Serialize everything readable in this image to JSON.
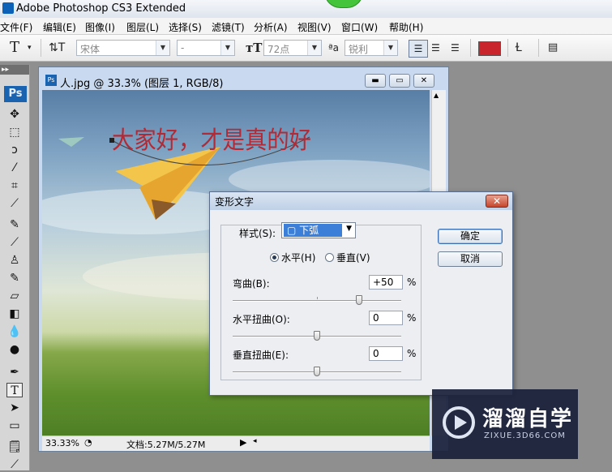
{
  "app": {
    "title": "Adobe Photoshop CS3 Extended",
    "menus": [
      "文件(F)",
      "编辑(E)",
      "图像(I)",
      "图层(L)",
      "选择(S)",
      "滤镜(T)",
      "分析(A)",
      "视图(V)",
      "窗口(W)",
      "帮助(H)"
    ]
  },
  "options": {
    "font_family": "宋体",
    "font_style": "-",
    "font_size": "72点",
    "antialias": "锐利",
    "text_color": "#c8252c"
  },
  "tools": {
    "panel_logo": "Ps",
    "icons": [
      "move-tool-icon",
      "marquee-tool-icon",
      "lasso-tool-icon",
      "magic-wand-icon",
      "crop-tool-icon",
      "slice-tool-icon",
      "healing-brush-icon",
      "brush-tool-icon",
      "clone-stamp-icon",
      "history-brush-icon",
      "eraser-tool-icon",
      "gradient-tool-icon",
      "blur-tool-icon",
      "dodge-tool-icon",
      "pen-tool-icon",
      "type-tool-icon",
      "path-select-icon",
      "shape-tool-icon",
      "notes-tool-icon",
      "eyedropper-icon"
    ]
  },
  "document": {
    "title": "人.jpg @ 33.3% (图层 1, RGB/8)",
    "canvas_text": "大家好，才是真的好",
    "zoom": "33.33%",
    "doc_info": "文档:5.27M/5.27M"
  },
  "dialog": {
    "title": "变形文字",
    "style_label": "样式(S):",
    "style_value": "下弧",
    "orientation_horizontal": "水平(H)",
    "orientation_vertical": "垂直(V)",
    "orientation_selected": "horizontal",
    "bend_label": "弯曲(B):",
    "bend_value": "+50",
    "bend_level": 0.75,
    "hdistort_label": "水平扭曲(O):",
    "hdistort_value": "0",
    "hdistort_level": 0.5,
    "vdistort_label": "垂直扭曲(E):",
    "vdistort_value": "0",
    "vdistort_level": 0.5,
    "percent": "%",
    "ok_label": "确定",
    "cancel_label": "取消"
  },
  "watermark": {
    "name": "溜溜自学",
    "url": "ZIXUE.3D66.COM"
  }
}
